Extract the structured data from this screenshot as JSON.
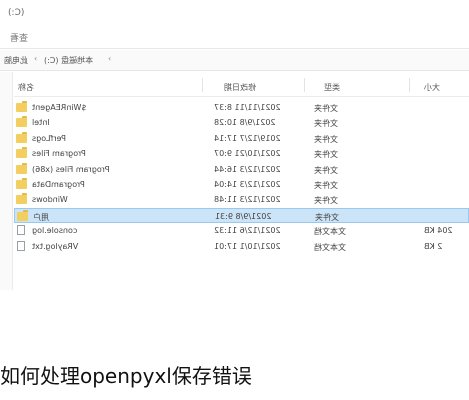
{
  "window": {
    "title": "(C:)"
  },
  "ribbon": {
    "tab_view": "查看"
  },
  "address": {
    "this_pc": "此电脑",
    "drive": "本地磁盘 (C:)"
  },
  "columns": {
    "name": "名称",
    "date": "修改日期",
    "type": "类型",
    "size": "大小"
  },
  "files": [
    {
      "name": "$WinREAgent",
      "date": "2021/11/11 8:37",
      "type": "文件夹",
      "size": "",
      "kind": "folder",
      "selected": false
    },
    {
      "name": "Intel",
      "date": "2021/9/8 10:28",
      "type": "文件夹",
      "size": "",
      "kind": "folder",
      "selected": false
    },
    {
      "name": "PerfLogs",
      "date": "2019/12/7 17:14",
      "type": "文件夹",
      "size": "",
      "kind": "folder",
      "selected": false
    },
    {
      "name": "Program Files",
      "date": "2021/10/21 9:07",
      "type": "文件夹",
      "size": "",
      "kind": "folder",
      "selected": false
    },
    {
      "name": "Program Files (x86)",
      "date": "2021/12/3 16:44",
      "type": "文件夹",
      "size": "",
      "kind": "folder",
      "selected": false
    },
    {
      "name": "ProgramData",
      "date": "2021/12/3 14:04",
      "type": "文件夹",
      "size": "",
      "kind": "folder",
      "selected": false
    },
    {
      "name": "Windows",
      "date": "2021/12/3 11:48",
      "type": "文件夹",
      "size": "",
      "kind": "folder",
      "selected": false
    },
    {
      "name": "用户",
      "date": "2021/9/8 9:31",
      "type": "文件夹",
      "size": "",
      "kind": "folder",
      "selected": true
    },
    {
      "name": "console.log",
      "date": "2021/12/6 11:32",
      "type": "文本文档",
      "size": "204 KB",
      "kind": "file",
      "selected": false
    },
    {
      "name": "VRaylog.txt",
      "date": "2021/10/1 17:01",
      "type": "文本文档",
      "size": "2 KB",
      "kind": "file",
      "selected": false
    }
  ],
  "caption": "如何处理openpyxl保存错误"
}
